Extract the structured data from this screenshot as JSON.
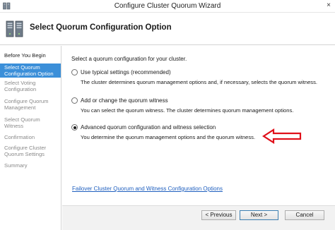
{
  "window": {
    "title": "Configure Cluster Quorum Wizard",
    "close_glyph": "×",
    "icon": "cluster-icon"
  },
  "header": {
    "title": "Select Quorum Configuration Option",
    "icon": "cluster-servers-icon"
  },
  "sidebar": {
    "items": [
      {
        "label": "Before You Begin",
        "state": "done"
      },
      {
        "label": "Select Quorum Configuration Option",
        "state": "active"
      },
      {
        "label": "Select Voting Configuration",
        "state": "pending"
      },
      {
        "label": "Configure Quorum Management",
        "state": "pending"
      },
      {
        "label": "Select Quorum Witness",
        "state": "pending"
      },
      {
        "label": "Confirmation",
        "state": "pending"
      },
      {
        "label": "Configure Cluster Quorum Settings",
        "state": "pending"
      },
      {
        "label": "Summary",
        "state": "pending"
      }
    ]
  },
  "main": {
    "intro": "Select a quorum configuration for your cluster.",
    "options": [
      {
        "label": "Use typical settings (recommended)",
        "description": "The cluster determines quorum management options and, if necessary, selects the quorum witness.",
        "selected": false
      },
      {
        "label": "Add or change the quorum witness",
        "description": "You can select the quorum witness. The cluster determines quorum management options.",
        "selected": false
      },
      {
        "label": "Advanced quorum configuration and witness selection",
        "description": "You determine the quorum management options and the quorum witness.",
        "selected": true
      }
    ],
    "annotation_arrow_color": "#e0101a",
    "link": "Failover Cluster Quorum and Witness Configuration Options"
  },
  "footer": {
    "previous": "< Previous",
    "next": "Next >",
    "cancel": "Cancel"
  },
  "colors": {
    "active_nav": "#3b8fd9",
    "link": "#1f5fbf",
    "footer_bg": "#f2f2f2"
  }
}
